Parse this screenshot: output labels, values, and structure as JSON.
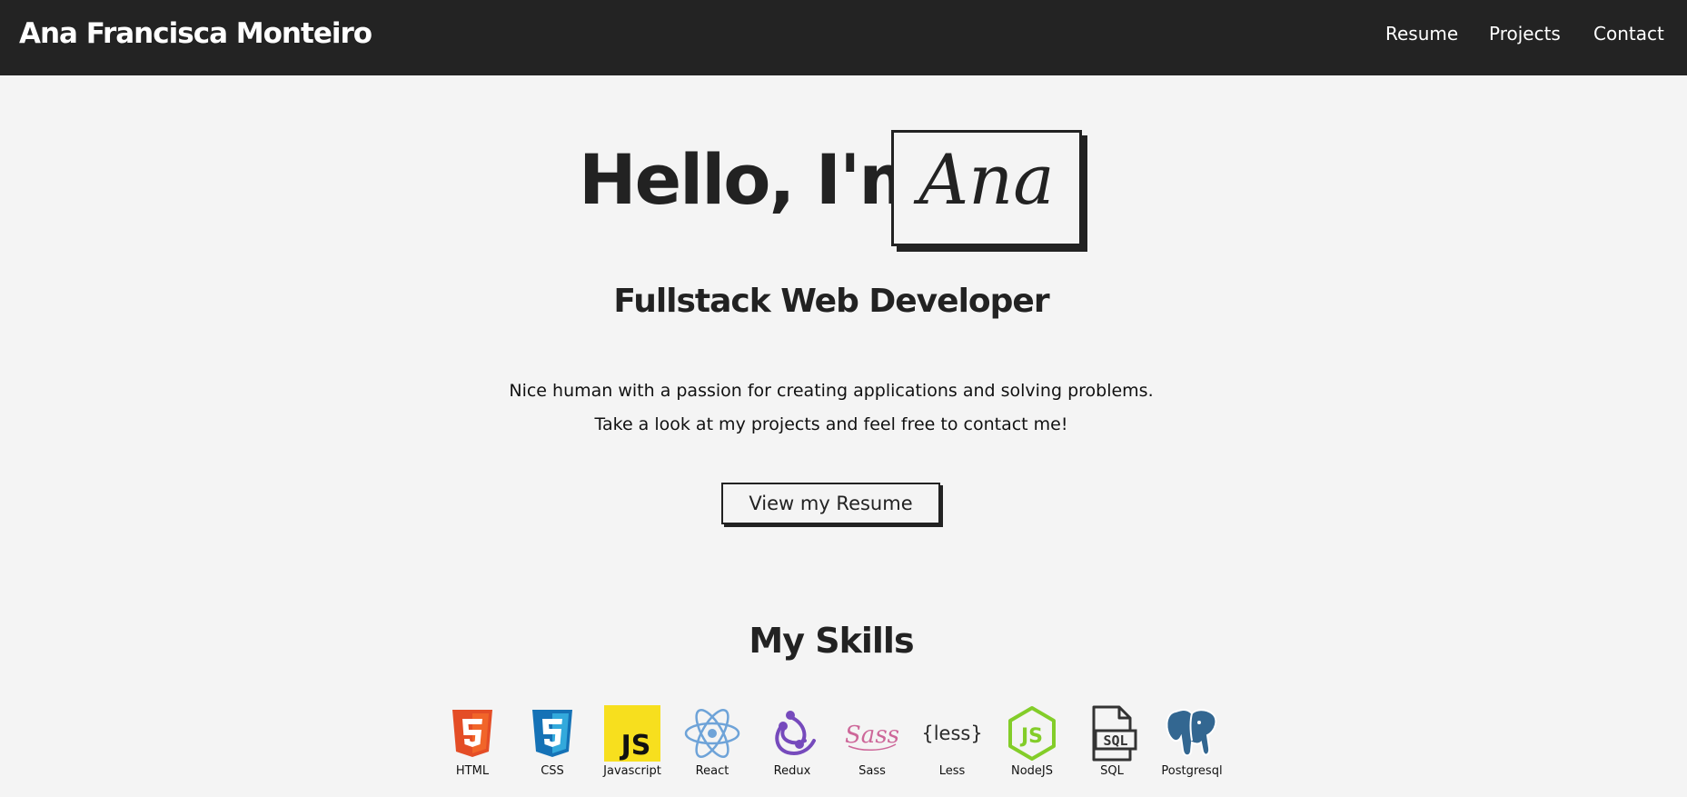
{
  "navbar": {
    "brand": "Ana Francisca Monteiro",
    "links": [
      "Resume",
      "Projects",
      "Contact"
    ]
  },
  "hero": {
    "greeting": "Hello, I'm",
    "name": "Ana",
    "subtitle": "Fullstack Web Developer",
    "description_line_1": "Nice human with a passion for creating applications and solving problems.",
    "description_line_2": "Take a look at my projects and feel free to contact me!",
    "button_label": "View my Resume"
  },
  "skills": {
    "title": "My Skills",
    "items": [
      {
        "label": "HTML",
        "icon": "html5-icon"
      },
      {
        "label": "CSS",
        "icon": "css3-icon"
      },
      {
        "label": "Javascript",
        "icon": "javascript-icon"
      },
      {
        "label": "React",
        "icon": "react-icon"
      },
      {
        "label": "Redux",
        "icon": "redux-icon"
      },
      {
        "label": "Sass",
        "icon": "sass-icon"
      },
      {
        "label": "Less",
        "icon": "less-icon"
      },
      {
        "label": "NodeJS",
        "icon": "nodejs-icon"
      },
      {
        "label": "SQL",
        "icon": "sql-icon"
      },
      {
        "label": "Postgresql",
        "icon": "postgresql-icon"
      }
    ]
  },
  "colors": {
    "navbar_bg": "#232323",
    "page_bg": "#f4f4f4",
    "text": "#222222"
  }
}
